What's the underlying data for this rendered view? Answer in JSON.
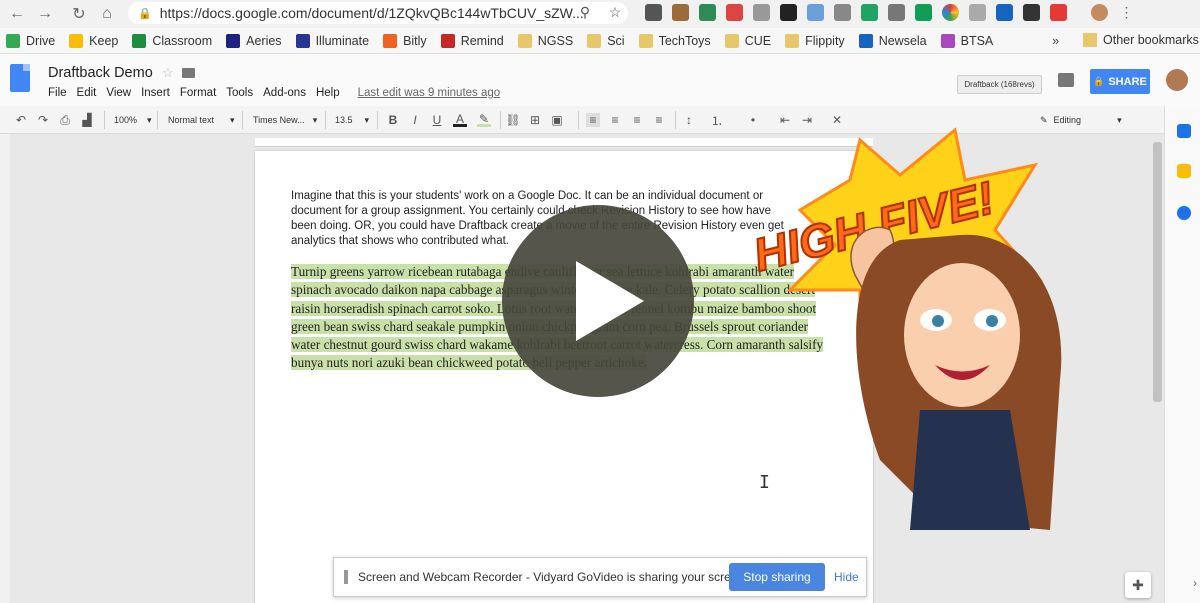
{
  "browser": {
    "url": "https://docs.google.com/document/d/1ZQkvQBc144wTbCUV_sZW...",
    "nav": {
      "back": "←",
      "forward": "→",
      "reload": "↻",
      "home": "⌂"
    }
  },
  "bookmarks": [
    {
      "label": "Drive",
      "color": "#34a853"
    },
    {
      "label": "Keep",
      "color": "#fbbc04"
    },
    {
      "label": "Classroom",
      "color": "#1e8e3e"
    },
    {
      "label": "Aeries",
      "color": "#1a237e"
    },
    {
      "label": "Illuminate",
      "color": "#283593"
    },
    {
      "label": "Bitly",
      "color": "#ee6123"
    },
    {
      "label": "Remind",
      "color": "#c62828"
    },
    {
      "label": "NGSS",
      "color": "#e8c76a"
    },
    {
      "label": "Sci",
      "color": "#e8c76a"
    },
    {
      "label": "TechToys",
      "color": "#e8c76a"
    },
    {
      "label": "CUE",
      "color": "#e8c76a"
    },
    {
      "label": "Flippity",
      "color": "#e8c76a"
    },
    {
      "label": "Newsela",
      "color": "#1565c0"
    },
    {
      "label": "BTSA",
      "color": "#ab47bc"
    }
  ],
  "bookmarks_more": "»",
  "bookmarks_other": "Other bookmarks",
  "docs": {
    "title": "Draftback Demo",
    "menu": [
      "File",
      "Edit",
      "View",
      "Insert",
      "Format",
      "Tools",
      "Add-ons",
      "Help"
    ],
    "last_edit": "Last edit was 9 minutes ago",
    "draftback_label": "Draftback (168revs)",
    "share_label": "SHARE",
    "toolbar": {
      "zoom": "100%",
      "style": "Normal text",
      "font": "Times New...",
      "size": "13.5",
      "mode": "Editing"
    }
  },
  "document": {
    "intro": "Imagine that this is your students' work on a Google Doc. It can be an individual document or document for a group assignment. You certainly could check Revision History to see how have been doing. OR, you could have Draftback create a movie of the entire Revision History even get analytics that shows who contributed what.",
    "highlighted": "Turnip greens yarrow ricebean rutabaga endive cauliflower sea lettuce kohlrabi amaranth water spinach avocado daikon napa cabbage asparagus winter purslane kale. Celery potato scallion desert raisin horseradish spinach carrot soko. Lotus root water spinach fennel kombu maize bamboo shoot green bean swiss chard seakale pumpkin onion chickpea gram corn pea. Brussels sprout coriander water chestnut gourd swiss chard wakame kohlrabi beetroot carrot watercress. Corn amaranth salsify bunya nuts nori azuki bean chickweed potato bell pepper artichoke."
  },
  "sharing_bar": {
    "message": "Screen and Webcam Recorder - Vidyard GoVideo is sharing your screen.",
    "stop_label": "Stop sharing",
    "hide_label": "Hide"
  },
  "sticker": {
    "text": "HIGH FIVE!"
  },
  "colors": {
    "share_blue": "#4285f4",
    "highlight_green": "#c9e0a8",
    "stop_blue": "#4a86e0",
    "sticker_yellow": "#ffd21a",
    "sticker_orange": "#ff6a1a"
  }
}
